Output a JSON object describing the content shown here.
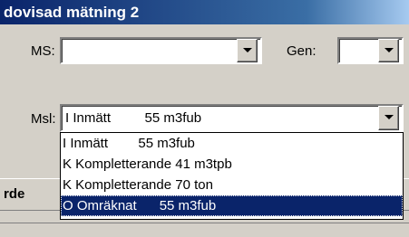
{
  "window": {
    "title": "dovisad mätning 2"
  },
  "form": {
    "ms_label": "MS:",
    "ms_value": "",
    "gen_label": "Gen:",
    "gen_value": "",
    "msl_label": "Msl:",
    "msl_value": "I Inmätt         55 m3fub"
  },
  "dropdown": {
    "items": [
      {
        "label": "I Inmätt        55 m3fub",
        "selected": false
      },
      {
        "label": "K Kompletterande 41 m3tpb",
        "selected": false
      },
      {
        "label": "K Kompletterande 70 ton",
        "selected": false
      },
      {
        "label": "O Omräknat      55 m3fub",
        "selected": true
      }
    ]
  },
  "grid": {
    "column_label": "rde"
  },
  "colors": {
    "selection": "#0a246a",
    "face": "#d4d0c8",
    "title_start": "#0a246a"
  },
  "icons": {
    "dropdown_arrow": "chevron-down-icon"
  }
}
